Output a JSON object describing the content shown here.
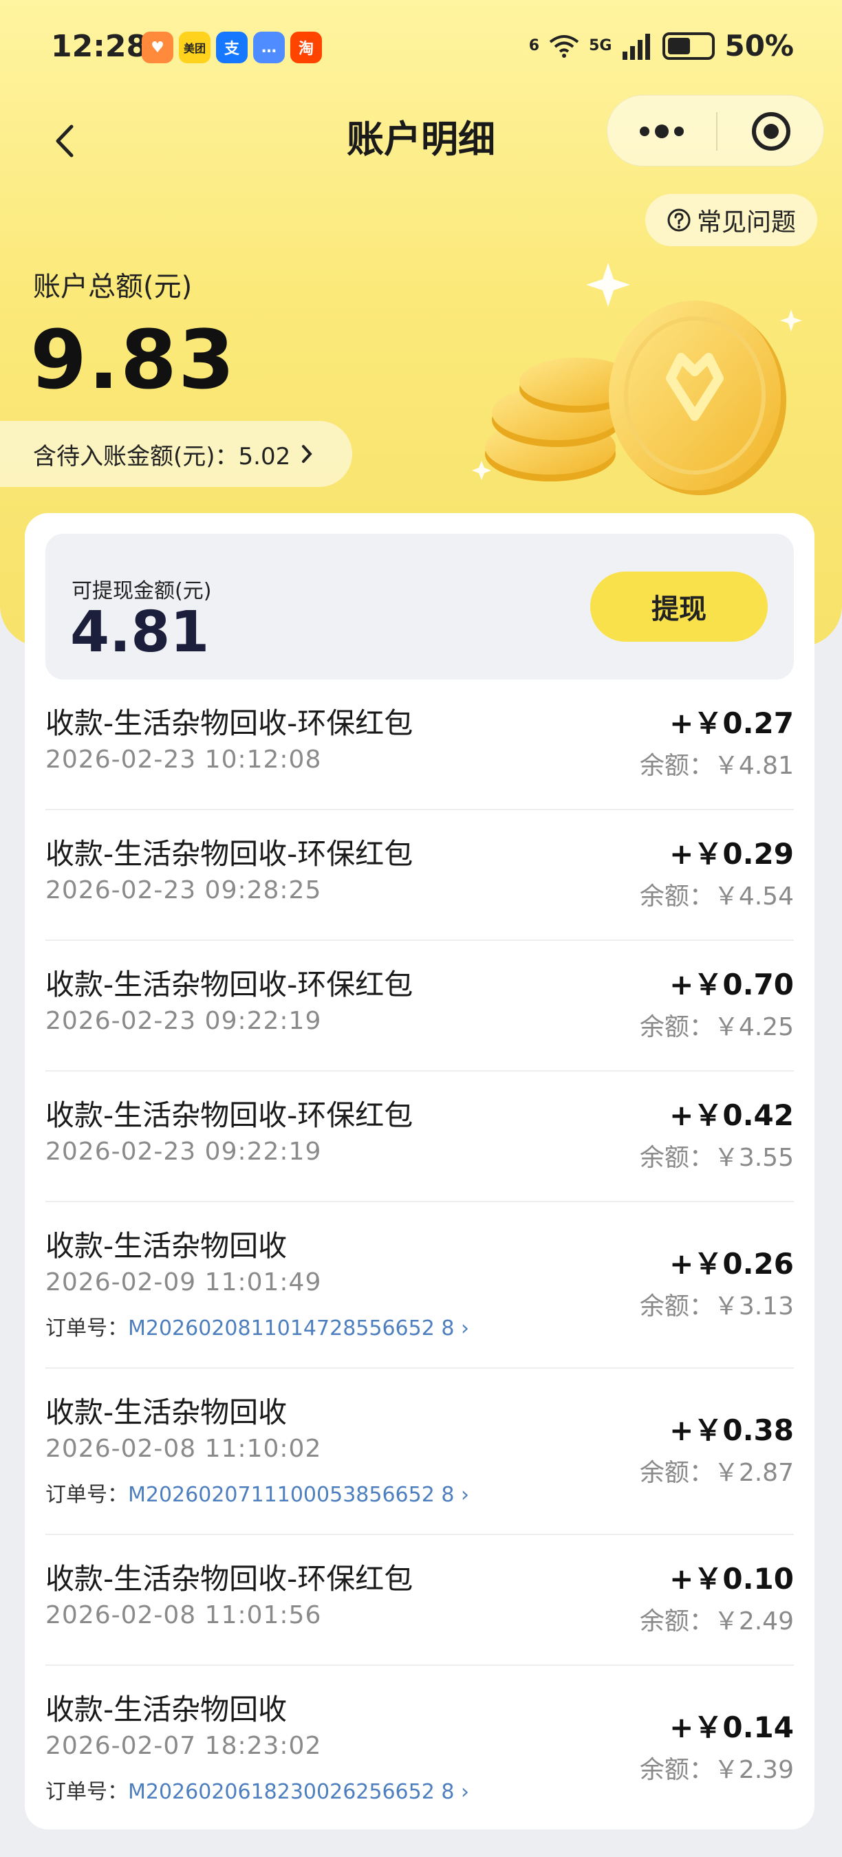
{
  "status_bar": {
    "time": "12:28",
    "apps": [
      {
        "label": "♥",
        "bg": "#ff8a3c",
        "icon": "heart-app-icon"
      },
      {
        "label": "美团",
        "bg": "#ffd31d",
        "icon": "meituan-icon"
      },
      {
        "label": "支",
        "bg": "#1677ff",
        "icon": "alipay-icon"
      },
      {
        "label": "…",
        "bg": "#4f8cff",
        "icon": "message-icon"
      },
      {
        "label": "淘",
        "bg": "#ff4400",
        "icon": "taobao-icon"
      }
    ],
    "network_top": "6",
    "network_5g": "5G",
    "battery": "50%"
  },
  "header": {
    "title": "账户明细",
    "faq": "常见问题"
  },
  "account": {
    "total_label": "账户总额(元)",
    "total_amount": "9.83",
    "pending_label": "含待入账金额(元)：5.02",
    "withdrawable_label": "可提现金额(元)",
    "withdrawable_amount": "4.81",
    "withdraw_button": "提现"
  },
  "transactions": [
    {
      "title": "收款-生活杂物回收-环保红包",
      "date": "2026-02-23 10:12:08",
      "amount": "+￥0.27",
      "balance": "余额：￥4.81"
    },
    {
      "title": "收款-生活杂物回收-环保红包",
      "date": "2026-02-23 09:28:25",
      "amount": "+￥0.29",
      "balance": "余额：￥4.54"
    },
    {
      "title": "收款-生活杂物回收-环保红包",
      "date": "2026-02-23 09:22:19",
      "amount": "+￥0.70",
      "balance": "余额：￥4.25"
    },
    {
      "title": "收款-生活杂物回收-环保红包",
      "date": "2026-02-23 09:22:19",
      "amount": "+￥0.42",
      "balance": "余额：￥3.55"
    },
    {
      "title": "收款-生活杂物回收",
      "date": "2026-02-09 11:01:49",
      "order_label": "订单号：",
      "order_no": "M2026020811014728556652 8 ›",
      "amount": "+￥0.26",
      "balance": "余额：￥3.13"
    },
    {
      "title": "收款-生活杂物回收",
      "date": "2026-02-08 11:10:02",
      "order_label": "订单号：",
      "order_no": "M2026020711100053856652 8 ›",
      "amount": "+￥0.38",
      "balance": "余额：￥2.87"
    },
    {
      "title": "收款-生活杂物回收-环保红包",
      "date": "2026-02-08 11:01:56",
      "amount": "+￥0.10",
      "balance": "余额：￥2.49"
    },
    {
      "title": "收款-生活杂物回收",
      "date": "2026-02-07 18:23:02",
      "order_label": "订单号：",
      "order_no": "M2026020618230026256652 8 ›",
      "amount": "+￥0.14",
      "balance": "余额：￥2.39"
    }
  ],
  "colors": {
    "accent_yellow": "#f8e14a",
    "link_blue": "#4d7fbf"
  }
}
